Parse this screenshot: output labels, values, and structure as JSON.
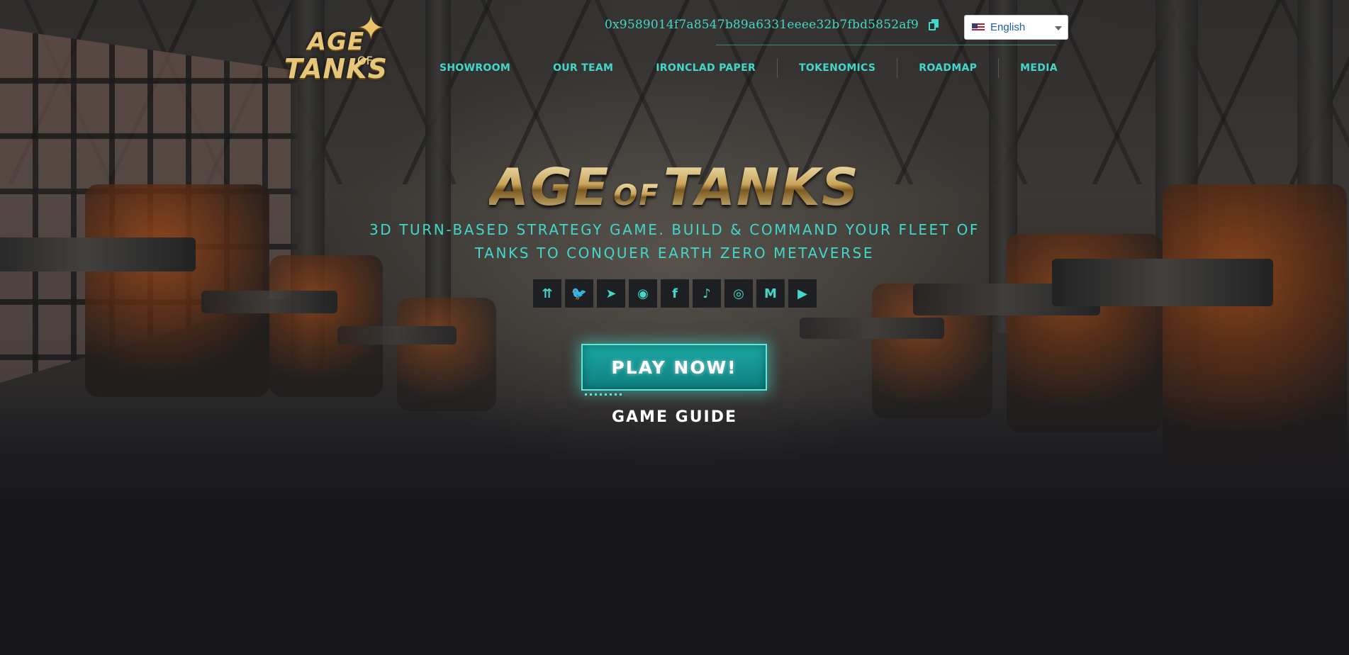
{
  "header": {
    "logo": {
      "line1": "AGE",
      "of": "OF",
      "line2": "TANKS"
    },
    "wallet_address": "0x9589014f7a8547b89a6331eeee32b7fbd5852af9",
    "language": {
      "selected": "English",
      "flag_icon": "us-flag-icon"
    },
    "nav": [
      {
        "label": "SHOWROOM"
      },
      {
        "label": "OUR TEAM"
      },
      {
        "label": "IRONCLAD PAPER"
      },
      {
        "label": "TOKENOMICS"
      },
      {
        "label": "ROADMAP"
      },
      {
        "label": "MEDIA"
      }
    ]
  },
  "hero": {
    "title_part1": "AGE",
    "title_of": "OF",
    "title_part2": "TANKS",
    "tagline": "3D turn-based strategy game. Build & command your fleet of tanks to conquer Earth Zero Metaverse",
    "social": [
      {
        "icon": "linktree-icon",
        "glyph": "⇈"
      },
      {
        "icon": "twitter-icon",
        "glyph": "🐦"
      },
      {
        "icon": "telegram-icon",
        "glyph": "➤"
      },
      {
        "icon": "discord-icon",
        "glyph": "◉"
      },
      {
        "icon": "facebook-icon",
        "glyph": "f"
      },
      {
        "icon": "tiktok-icon",
        "glyph": "♪"
      },
      {
        "icon": "instagram-icon",
        "glyph": "◎"
      },
      {
        "icon": "medium-icon",
        "glyph": "M"
      },
      {
        "icon": "youtube-icon",
        "glyph": "▶"
      }
    ],
    "play_button": "PLAY NOW!",
    "game_guide": "GAME GUIDE"
  },
  "colors": {
    "accent": "#43d7c9",
    "gold": "#dcc690",
    "background": "#1b1b1f"
  }
}
